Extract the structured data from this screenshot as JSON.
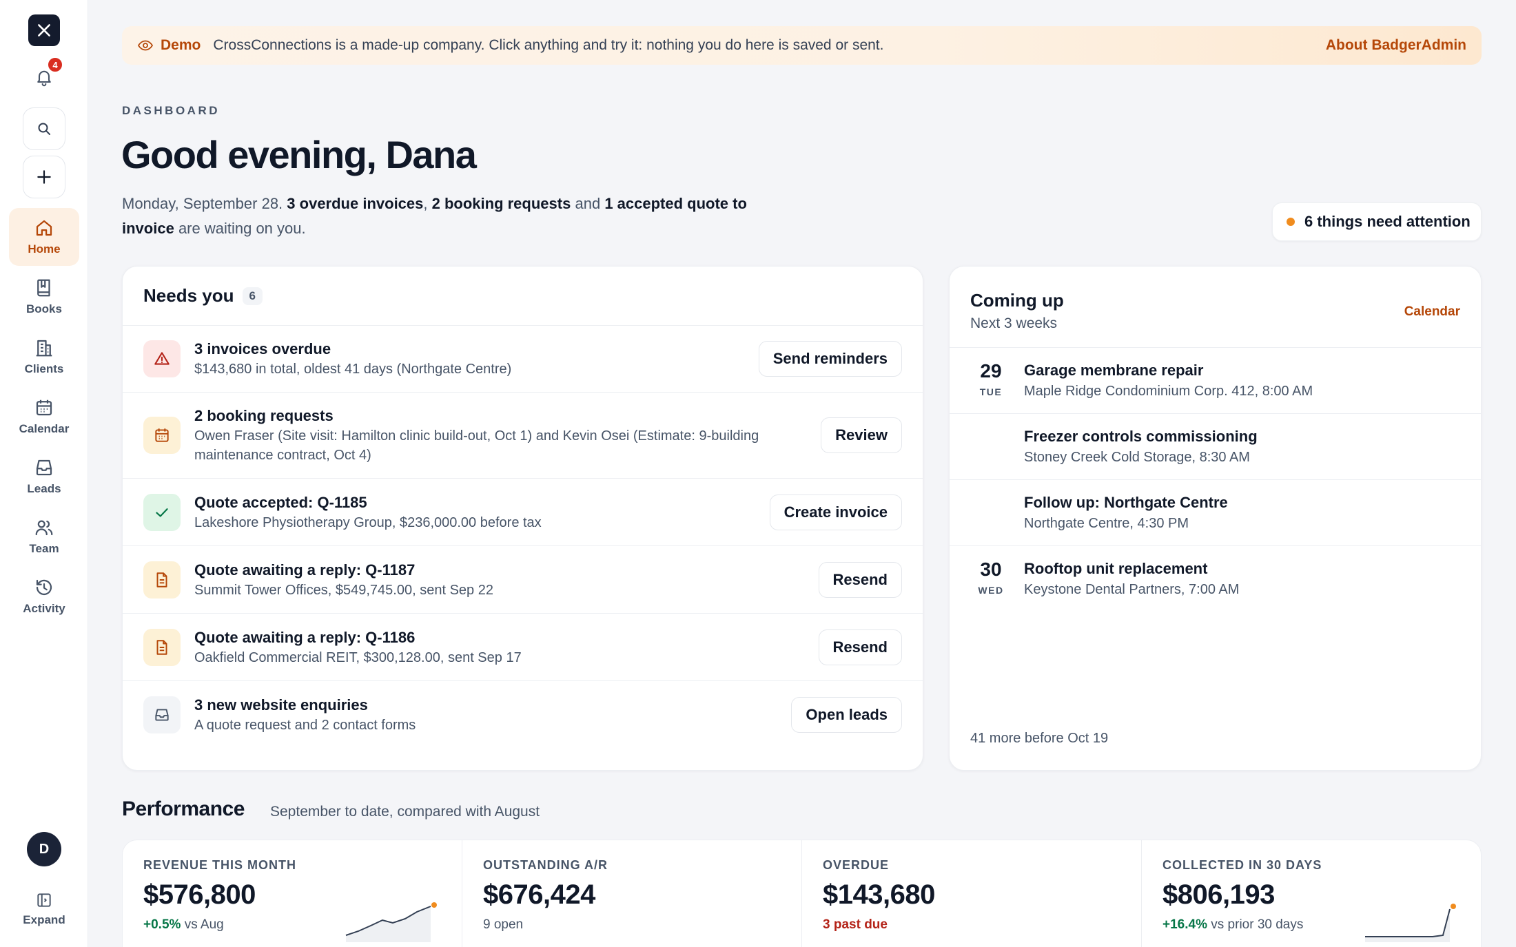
{
  "sidebar": {
    "notification_count": "4",
    "items": [
      {
        "label": "Home",
        "icon": "home-icon"
      },
      {
        "label": "Books",
        "icon": "book-icon"
      },
      {
        "label": "Clients",
        "icon": "building-icon"
      },
      {
        "label": "Calendar",
        "icon": "calendar-icon"
      },
      {
        "label": "Leads",
        "icon": "inbox-icon"
      },
      {
        "label": "Team",
        "icon": "users-icon"
      },
      {
        "label": "Activity",
        "icon": "history-icon"
      }
    ],
    "avatar_initial": "D",
    "expand_label": "Expand"
  },
  "banner": {
    "tag": "Demo",
    "message": "CrossConnections is a made-up company. Click anything and try it: nothing you do here is saved or sent.",
    "link": "About BadgerAdmin"
  },
  "header": {
    "eyebrow": "DASHBOARD",
    "greeting": "Good evening, Dana",
    "date": "Monday, September 28.",
    "overdue": "3 overdue invoices",
    "bookings": "2 booking requests",
    "and": "and",
    "accepted": "1 accepted quote to invoice",
    "tail": "are waiting on you.",
    "attention": "6 things need attention"
  },
  "needs": {
    "title": "Needs you",
    "count": "6",
    "rows": [
      {
        "title": "3 invoices overdue",
        "sub": "$143,680 in total, oldest 41 days (Northgate Centre)",
        "action": "Send reminders"
      },
      {
        "title": "2 booking requests",
        "sub": "Owen Fraser (Site visit: Hamilton clinic build-out, Oct 1) and Kevin Osei (Estimate: 9-building maintenance contract, Oct 4)",
        "action": "Review"
      },
      {
        "title": "Quote accepted: Q-1185",
        "sub": "Lakeshore Physiotherapy Group, $236,000.00 before tax",
        "action": "Create invoice"
      },
      {
        "title": "Quote awaiting a reply: Q-1187",
        "sub": "Summit Tower Offices, $549,745.00, sent Sep 22",
        "action": "Resend"
      },
      {
        "title": "Quote awaiting a reply: Q-1186",
        "sub": "Oakfield Commercial REIT, $300,128.00, sent Sep 17",
        "action": "Resend"
      },
      {
        "title": "3 new website enquiries",
        "sub": "A quote request and 2 contact forms",
        "action": "Open leads"
      }
    ]
  },
  "coming": {
    "title": "Coming up",
    "sub": "Next 3 weeks",
    "link": "Calendar",
    "events": [
      {
        "day": "29",
        "dow": "TUE",
        "title": "Garage membrane repair",
        "sub": "Maple Ridge Condominium Corp. 412, 8:00 AM"
      },
      {
        "day": "",
        "dow": "",
        "title": "Freezer controls commissioning",
        "sub": "Stoney Creek Cold Storage, 8:30 AM"
      },
      {
        "day": "",
        "dow": "",
        "title": "Follow up: Northgate Centre",
        "sub": "Northgate Centre, 4:30 PM"
      },
      {
        "day": "30",
        "dow": "WED",
        "title": "Rooftop unit replacement",
        "sub": "Keystone Dental Partners, 7:00 AM"
      }
    ],
    "more": "41 more before Oct 19"
  },
  "performance": {
    "title": "Performance",
    "sub": "September to date, compared with August",
    "metrics": [
      {
        "label": "REVENUE THIS MONTH",
        "value": "$576,800",
        "delta": "+0.5%",
        "foot": "vs Aug"
      },
      {
        "label": "OUTSTANDING A/R",
        "value": "$676,424",
        "foot": "9 open"
      },
      {
        "label": "OVERDUE",
        "value": "$143,680",
        "foot": "3 past due"
      },
      {
        "label": "COLLECTED IN 30 DAYS",
        "value": "$806,193",
        "delta": "+16.4%",
        "foot": "vs prior 30 days"
      }
    ]
  },
  "colors": {
    "accent": "#b54708",
    "dot": "#f08c1e",
    "positive": "#067647",
    "negative": "#b42318"
  }
}
